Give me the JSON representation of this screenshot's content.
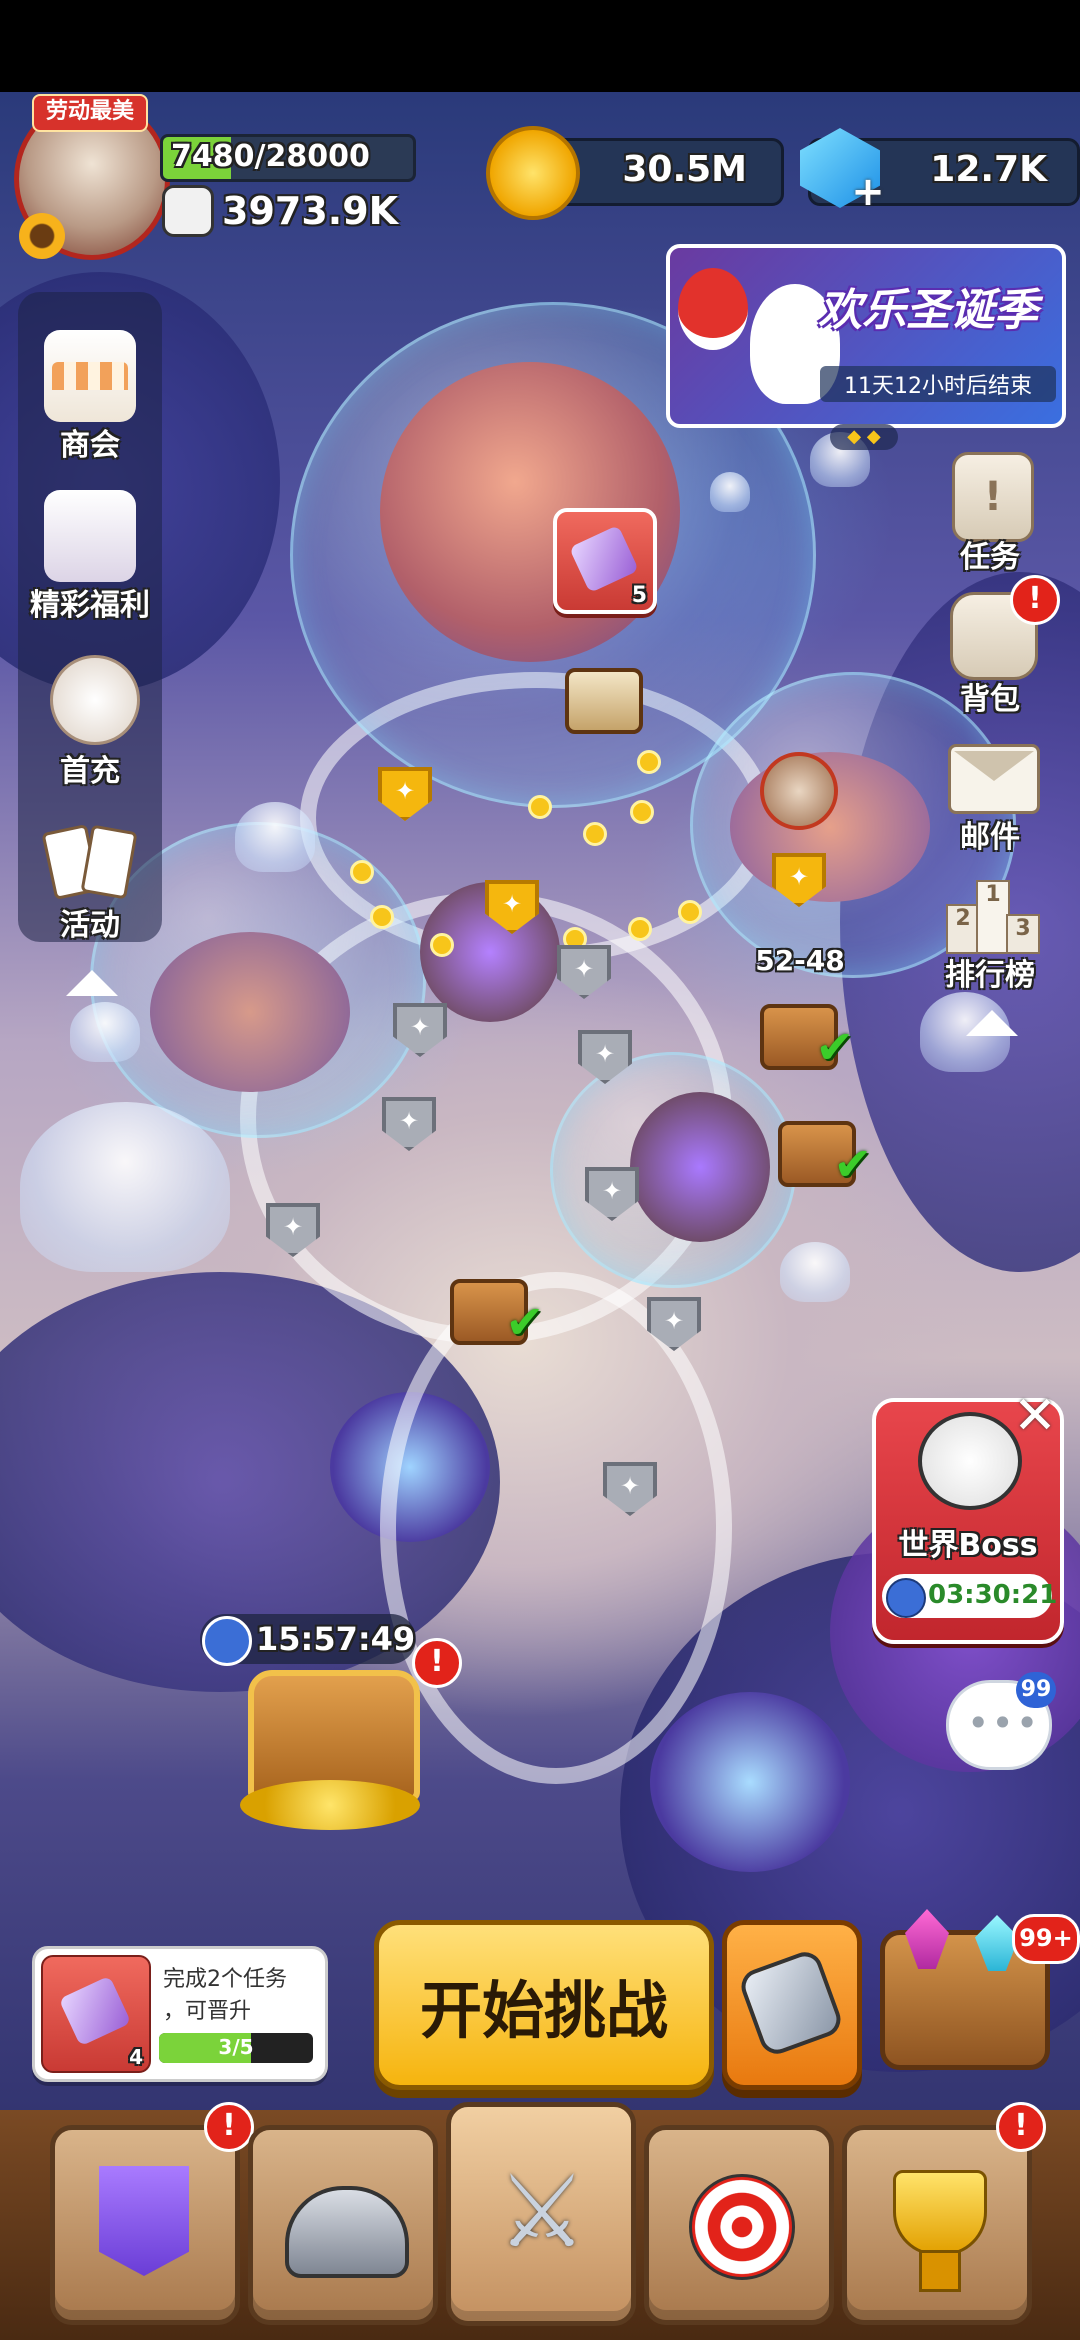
{
  "player": {
    "title_badge": "劳动最美",
    "exp": "7480/28000",
    "power": "3973.9K",
    "flower_icon": "sunflower-icon"
  },
  "currencies": {
    "gold": "30.5M",
    "gems": "12.7K"
  },
  "event_banner": {
    "title": "欢乐圣诞季",
    "countdown": "11天12小时后结束"
  },
  "left_menu": [
    {
      "label": "商会",
      "icon": "shop-icon"
    },
    {
      "label": "精彩福利",
      "icon": "gift-box-icon"
    },
    {
      "label": "首充",
      "icon": "first-recharge-icon"
    },
    {
      "label": "活动",
      "icon": "cards-icon"
    }
  ],
  "right_menu": [
    {
      "label": "任务",
      "icon": "scroll-icon"
    },
    {
      "label": "背包",
      "icon": "backpack-icon",
      "alert": "!"
    },
    {
      "label": "邮件",
      "icon": "envelope-icon"
    },
    {
      "label": "排行榜",
      "icon": "podium-icon"
    }
  ],
  "podium": {
    "first": "1",
    "second": "2",
    "third": "3"
  },
  "map": {
    "current_stage": "52-48",
    "scroll_reward_count": "5"
  },
  "world_boss": {
    "label": "世界Boss",
    "timer": "03:30:21"
  },
  "chat": {
    "unread": "99"
  },
  "treasure": {
    "timer": "15:57:49",
    "alert": "!"
  },
  "battle_pass": {
    "count": "99+"
  },
  "quest_progress": {
    "text": "完成2个任务，可晋升",
    "line1": "完成2个任务",
    "line2": "，可晋升",
    "progress": "3/5",
    "progress_value": 0.6,
    "item_count": "4"
  },
  "start_button": {
    "label": "开始挑战"
  },
  "bottom_nav": [
    {
      "name": "banner-tab",
      "icon": "sword-banner-icon",
      "alert": "!"
    },
    {
      "name": "helmet-tab",
      "icon": "viking-helmet-icon",
      "alert": ""
    },
    {
      "name": "battle-tab",
      "icon": "crossed-swords-icon",
      "alert": ""
    },
    {
      "name": "target-tab",
      "icon": "dartboard-icon",
      "alert": ""
    },
    {
      "name": "trophy-tab",
      "icon": "trophy-icon",
      "alert": "!"
    }
  ],
  "colors": {
    "accent_gold": "#f7c51a",
    "alert_red": "#e2231a",
    "exp_green": "#7bd33a",
    "boss_red": "#d8323a"
  }
}
